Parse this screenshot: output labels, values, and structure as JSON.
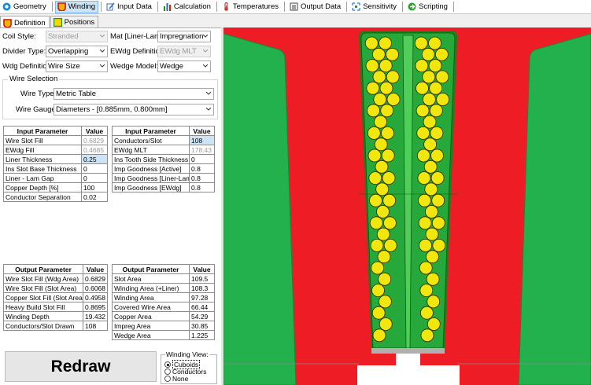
{
  "topbar": {
    "tabs": [
      {
        "label": "Geometry",
        "icon": "geometry-icon"
      },
      {
        "label": "Winding",
        "icon": "winding-icon"
      },
      {
        "label": "Input Data",
        "icon": "input-data-icon"
      },
      {
        "label": "Calculation",
        "icon": "calculation-icon"
      },
      {
        "label": "Temperatures",
        "icon": "temperatures-icon"
      },
      {
        "label": "Output Data",
        "icon": "output-data-icon"
      },
      {
        "label": "Sensitivity",
        "icon": "sensitivity-icon"
      },
      {
        "label": "Scripting",
        "icon": "scripting-icon"
      }
    ],
    "selected": "Winding"
  },
  "subtabs": [
    {
      "label": "Definition",
      "icon": "definition-icon"
    },
    {
      "label": "Positions",
      "icon": "positions-icon"
    }
  ],
  "form": {
    "coil_style": {
      "label": "Coil Style:",
      "value": "Stranded"
    },
    "mat": {
      "label": "Mat [Liner-Lam]:",
      "value": "Impregnation"
    },
    "divider_type": {
      "label": "Divider Type:",
      "value": "Overlapping"
    },
    "ewdg_definition": {
      "label": "EWdg Definition:",
      "value": "EWdg MLT"
    },
    "wdg_definition": {
      "label": "Wdg Definition:",
      "value": "Wire Size"
    },
    "wedge_model": {
      "label": "Wedge Model:",
      "value": "Wedge"
    },
    "wire_selection": {
      "caption": "Wire Selection",
      "wire_type": {
        "label": "Wire Type:",
        "value": "Metric Table"
      },
      "wire_gauge": {
        "label": "Wire Gauge:",
        "value": "Diameters  - [0.885mm, 0.800mm]"
      }
    }
  },
  "input_table_1": {
    "headers": [
      "Input Parameter",
      "Value"
    ],
    "rows": [
      [
        "Wire Slot Fill",
        "0.6829"
      ],
      [
        "EWdg Fill",
        "0.4685"
      ],
      [
        "Liner Thickness",
        "0.25"
      ],
      [
        "Ins Slot Base Thickness",
        "0"
      ],
      [
        "Liner - Lam Gap",
        "0"
      ],
      [
        "Copper Depth [%]",
        "100"
      ],
      [
        "Conductor Separation",
        "0.02"
      ]
    ]
  },
  "input_table_2": {
    "headers": [
      "Input Parameter",
      "Value"
    ],
    "rows": [
      [
        "Conductors/Slot",
        "108"
      ],
      [
        "EWdg MLT",
        "178.43"
      ],
      [
        "Ins Tooth Side Thickness",
        "0"
      ],
      [
        "Imp Goodness [Active]",
        "0.8"
      ],
      [
        "Imp Goodness [Liner-Lam]",
        "0.8"
      ],
      [
        "Imp Goodness [EWdg]",
        "0.8"
      ]
    ]
  },
  "output_table_1": {
    "headers": [
      "Output Parameter",
      "Value"
    ],
    "rows": [
      [
        "Wire Slot Fill (Wdg Area)",
        "0.6829"
      ],
      [
        "Wire Slot Fill (Slot Area)",
        "0.6068"
      ],
      [
        "Copper Slot Fill (Slot Area)",
        "0.4958"
      ],
      [
        "Heavy Build Slot Fill",
        "0.8695"
      ],
      [
        "Winding Depth",
        "19.432"
      ],
      [
        "Conductors/Slot Drawn",
        "108"
      ]
    ]
  },
  "output_table_2": {
    "headers": [
      "Output Parameter",
      "Value"
    ],
    "rows": [
      [
        "Slot Area",
        "109.5"
      ],
      [
        "Winding Area (+Liner)",
        "108.3"
      ],
      [
        "Winding Area",
        "97.28"
      ],
      [
        "Covered Wire Area",
        "66.44"
      ],
      [
        "Copper Area",
        "54.29"
      ],
      [
        "Impreg Area",
        "30.85"
      ],
      [
        "Wedge Area",
        "1.225"
      ]
    ]
  },
  "redraw_label": "Redraw",
  "winding_view": {
    "caption": "Winding View:",
    "options": [
      "Cuboids",
      "Conductors",
      "None"
    ],
    "selected": "Cuboids"
  },
  "colors": {
    "lamination": "#ee1c24",
    "tooth_green": "#22b14c",
    "liner": "#1e7d1e",
    "conductor": "#f2e60f",
    "conductor_edge": "#2a2a00",
    "background": "#ffffff",
    "selection": "#cde4f7"
  }
}
